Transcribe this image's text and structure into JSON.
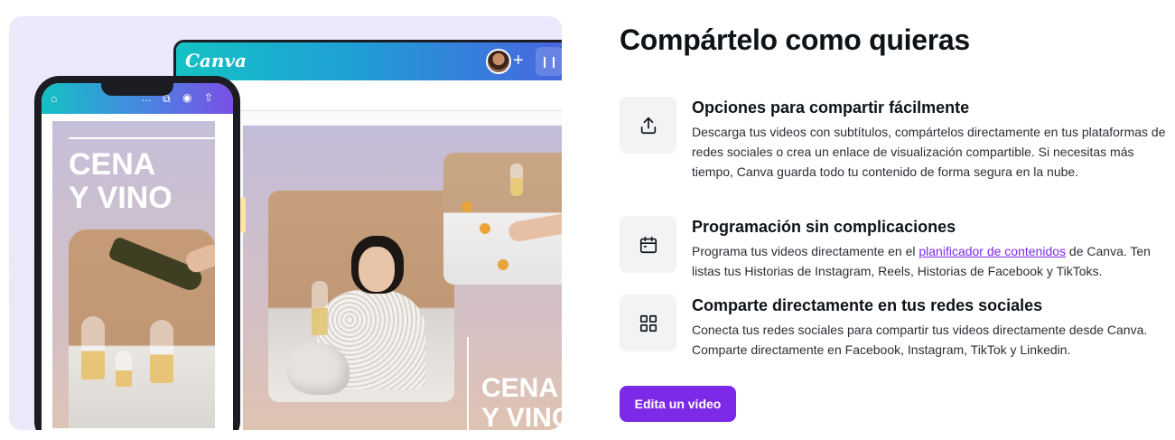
{
  "illustration": {
    "desktop_logo": "Canva",
    "desktop_plus": "+",
    "desktop_stats": "❙❙",
    "desktop_caption": [
      "CENA",
      "Y VINO"
    ],
    "phone_title": [
      "CENA",
      "Y VINO"
    ],
    "phone_toolbar": {
      "home": "⌂",
      "more": "…",
      "copy": "⧉",
      "preview": "◉",
      "share": "⇧"
    }
  },
  "section": {
    "title": "Compártelo como quieras"
  },
  "features": [
    {
      "icon": "share-upload-icon",
      "title": "Opciones para compartir fácilmente",
      "description": "Descarga tus videos con subtítulos, compártelos directamente en tus plataformas de redes sociales o crea un enlace de visualización compartible. Si necesitas más tiempo, Canva guarda todo tu contenido de forma segura en la nube."
    },
    {
      "icon": "calendar-icon",
      "title": "Programación sin complicaciones",
      "description_before": "Programa tus videos directamente en el ",
      "link": "planificador de contenidos",
      "description_after": " de Canva. Ten listas tus Historias de Instagram, Reels, Historias de Facebook y TikToks."
    },
    {
      "icon": "apps-grid-icon",
      "title": "Comparte directamente en tus redes sociales",
      "description": "Conecta tus redes sociales para compartir tus videos directamente desde Canva. Comparte directamente en Facebook, Instagram, TikTok y Linkedin."
    }
  ],
  "cta": {
    "label": "Edita un video"
  },
  "colors": {
    "accent": "#7d2ae8",
    "icon_bg": "#f2f3f5",
    "hero_bg": "#ede9fb"
  }
}
